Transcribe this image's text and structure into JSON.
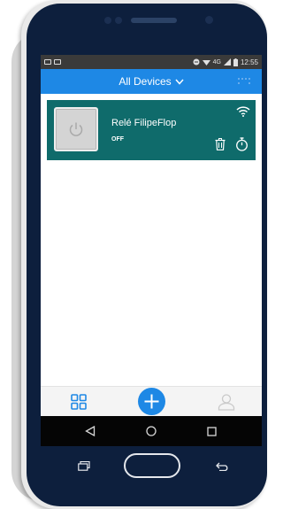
{
  "status_bar": {
    "network_label": "4G",
    "time": "12:55"
  },
  "app_bar": {
    "title": "All Devices",
    "title_chevron": "chevron-down-icon",
    "more_icon": "more-dots-icon"
  },
  "device": {
    "name": "Relé FilipeFlop",
    "state": "OFF",
    "power_icon": "power-icon",
    "wifi_icon": "wifi-icon",
    "delete_icon": "trash-icon",
    "timer_icon": "timer-icon"
  },
  "bottom_nav": {
    "items": [
      "grid-icon",
      "add-icon",
      "user-icon"
    ]
  },
  "softkeys": [
    "back-icon",
    "home-icon",
    "recents-icon"
  ],
  "colors": {
    "app_bar": "#1e88e5",
    "card": "#0f6b6b",
    "accent": "#1e88e5",
    "phone_body": "#0d1f3d"
  }
}
